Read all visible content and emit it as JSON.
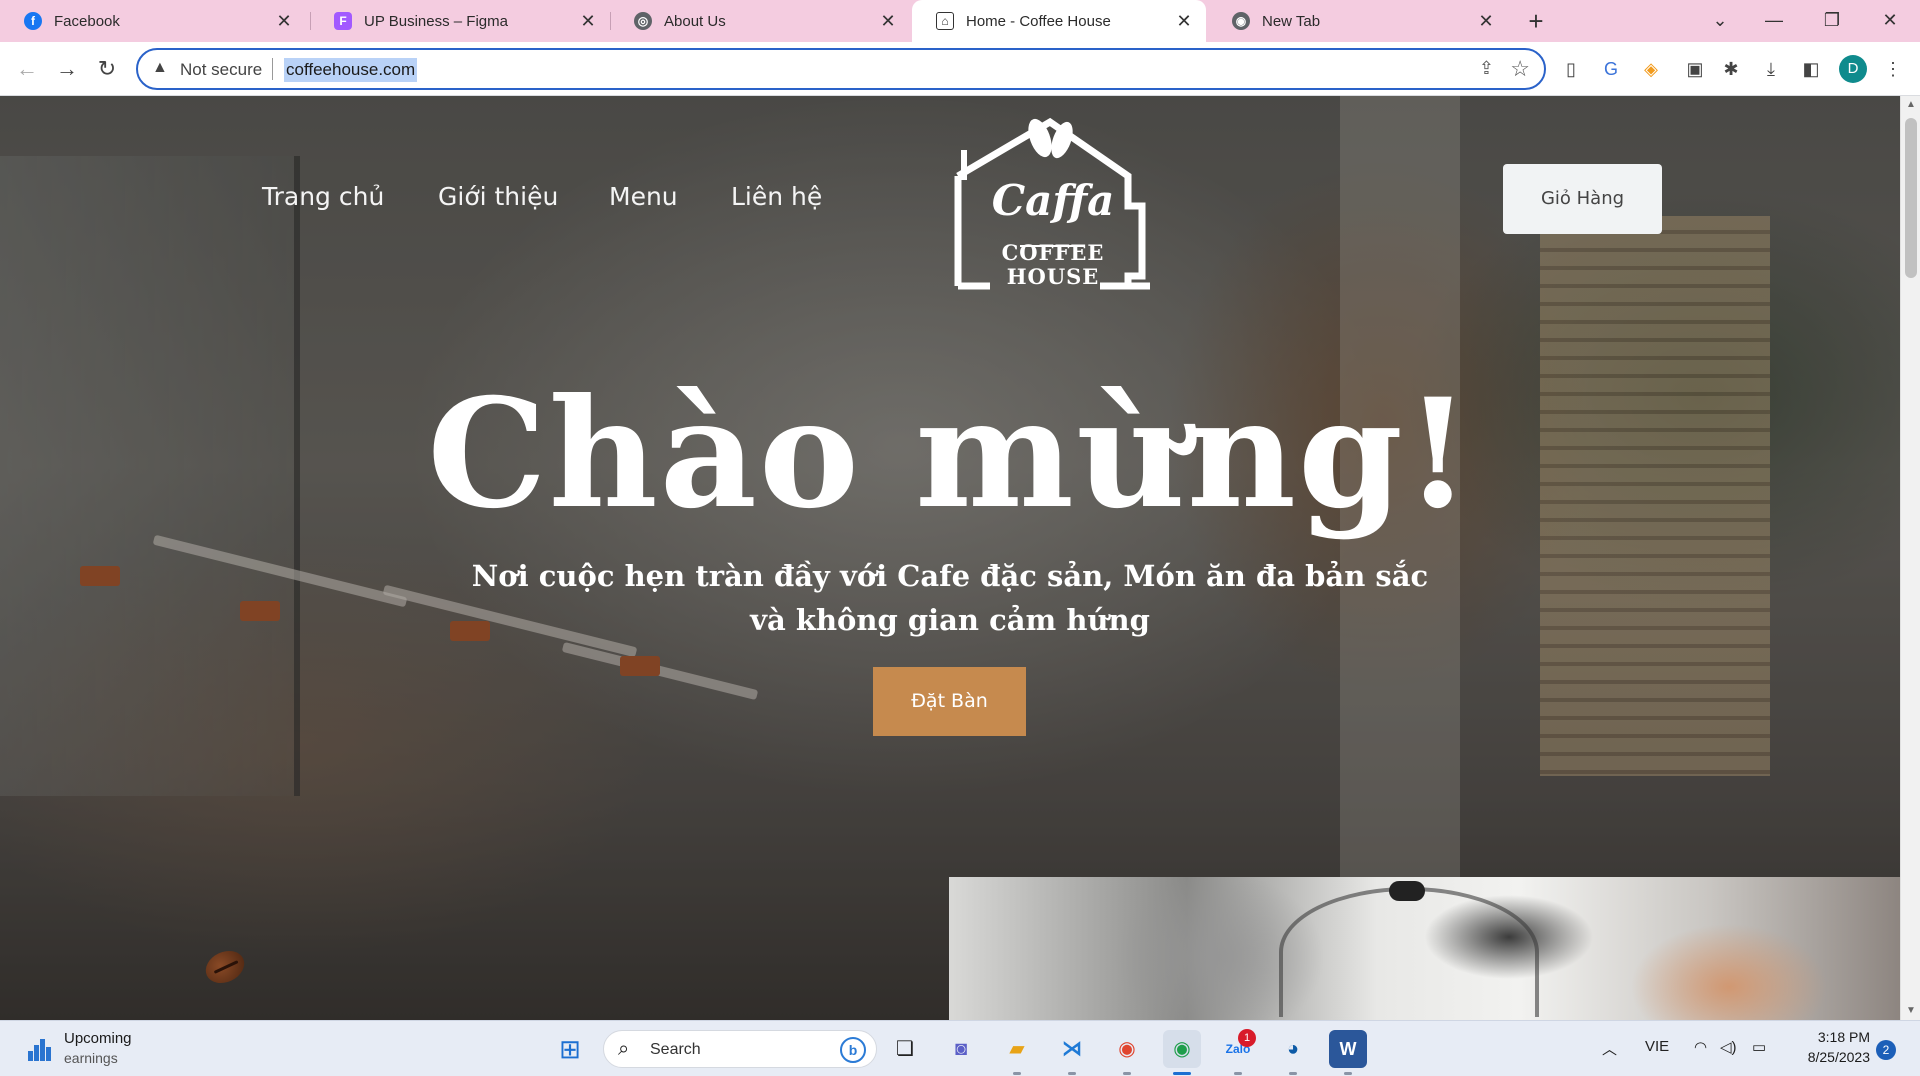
{
  "browser": {
    "tabs": [
      {
        "title": "Facebook",
        "icon": "facebook-icon",
        "color": "#1877f2",
        "glyph": "f"
      },
      {
        "title": "UP Business – Figma",
        "icon": "figma-icon",
        "color": "#a259ff",
        "glyph": "F"
      },
      {
        "title": "About Us",
        "icon": "globe-icon",
        "color": "#5f6368",
        "glyph": "◎"
      },
      {
        "title": "Home - Coffee House",
        "icon": "coffee-house-icon",
        "color": "#333333",
        "glyph": "⌂"
      },
      {
        "title": "New Tab",
        "icon": "chrome-icon",
        "color": "#5f6368",
        "glyph": "◉"
      }
    ],
    "active_tab": 3,
    "address": {
      "security": "Not secure",
      "url": "coffeehouse.com"
    },
    "profile_initial": "D"
  },
  "site": {
    "nav": {
      "home": "Trang chủ",
      "about": "Giới thiệu",
      "menu": "Menu",
      "contact": "Liên hệ"
    },
    "logo": {
      "script": "Caffa",
      "line1": "COFFEE",
      "line2": "HOUSE"
    },
    "cart_label": "Giỏ Hàng",
    "headline": "Chào mừng!",
    "subtitle": "Nơi cuộc hẹn tràn đầy với Cafe đặc sản, Món ăn đa bản sắc và không gian cảm hứng",
    "book_label": "Đặt Bàn",
    "colors": {
      "accent": "#c68a4e",
      "cart_bg": "#f1f3f4"
    }
  },
  "taskbar": {
    "weather_title": "Upcoming",
    "weather_sub": "earnings",
    "search_label": "Search",
    "zalo_badge": "1",
    "language": "VIE",
    "time": "3:18 PM",
    "date": "8/25/2023",
    "notifications": "2"
  }
}
